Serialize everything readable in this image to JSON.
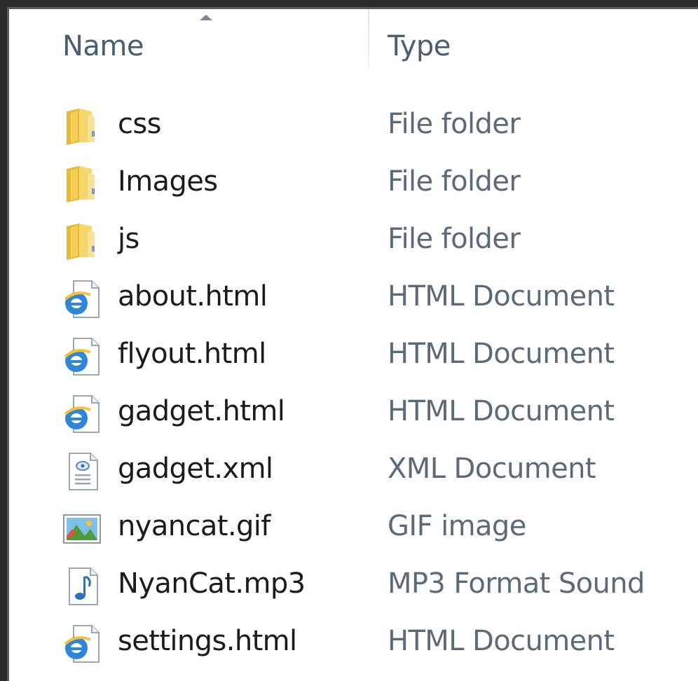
{
  "columns": {
    "name_label": "Name",
    "type_label": "Type",
    "sorted_column": "name",
    "sort_direction": "ascending"
  },
  "files": [
    {
      "name": "css",
      "type": "File folder",
      "icon": "folder-icon"
    },
    {
      "name": "Images",
      "type": "File folder",
      "icon": "folder-icon"
    },
    {
      "name": "js",
      "type": "File folder",
      "icon": "folder-icon"
    },
    {
      "name": "about.html",
      "type": "HTML Document",
      "icon": "ie-html-icon"
    },
    {
      "name": "flyout.html",
      "type": "HTML Document",
      "icon": "ie-html-icon"
    },
    {
      "name": "gadget.html",
      "type": "HTML Document",
      "icon": "ie-html-icon"
    },
    {
      "name": "gadget.xml",
      "type": "XML Document",
      "icon": "xml-document-icon"
    },
    {
      "name": "nyancat.gif",
      "type": "GIF image",
      "icon": "image-icon"
    },
    {
      "name": "NyanCat.mp3",
      "type": "MP3 Format Sound",
      "icon": "audio-note-icon"
    },
    {
      "name": "settings.html",
      "type": "HTML Document",
      "icon": "ie-html-icon"
    }
  ],
  "colors": {
    "header_text": "#4a5d73",
    "name_text": "#1b1b1b",
    "type_text": "#5b6a79",
    "folder_yellow": "#f0c64a",
    "ie_blue": "#1e73c8"
  }
}
